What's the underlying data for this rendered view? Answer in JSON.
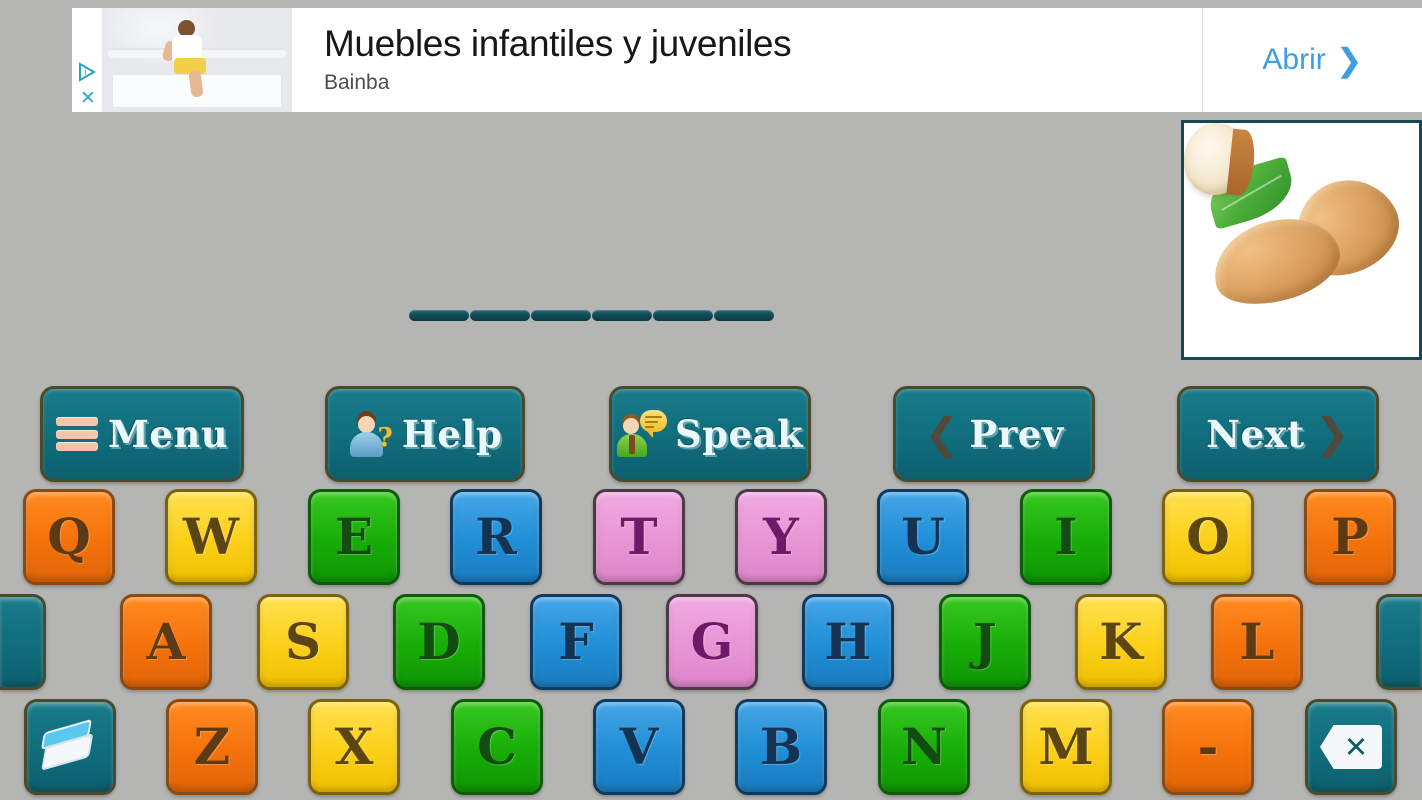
{
  "screen": {
    "background_color": "#b5b5b4",
    "app_kind": "hangman-style word guessing game keyboard"
  },
  "ad": {
    "title": "Muebles infantiles y juveniles",
    "advertiser": "Bainba",
    "cta_label": "Abrir",
    "cta_chevron": "❯",
    "adchoices_icon": "adchoices-triangle-i-icon",
    "close_icon": "✕",
    "thumbnail_icon": "nursery-furniture-photo",
    "accent_color": "#3e9fe0"
  },
  "picture_card": {
    "image_icon": "almonds-photo",
    "border_color": "#15484f",
    "background_color": "#ffffff"
  },
  "word": {
    "slot_count": 6,
    "slots": [
      "",
      "",
      "",
      "",
      "",
      ""
    ],
    "slot_color": "#114854"
  },
  "actions": [
    {
      "id": "menu",
      "label": "Menu",
      "icon": "hamburger-icon"
    },
    {
      "id": "help",
      "label": "Help",
      "icon": "person-question-icon"
    },
    {
      "id": "speak",
      "label": "Speak",
      "icon": "person-speech-bubble-icon"
    },
    {
      "id": "prev",
      "label": "Prev",
      "icon": "chevron-left-icon"
    },
    {
      "id": "next",
      "label": "Next",
      "icon": "chevron-right-icon"
    }
  ],
  "action_style": {
    "fill_color": "#11707f",
    "border_color": "#4b4a2a",
    "text_color": "#eaf7fb"
  },
  "keyboard": {
    "rows": [
      {
        "id": "row-1",
        "keys": [
          {
            "label": "Q",
            "color": "orange"
          },
          {
            "label": "W",
            "color": "yellow"
          },
          {
            "label": "E",
            "color": "green"
          },
          {
            "label": "R",
            "color": "blue"
          },
          {
            "label": "T",
            "color": "pink"
          },
          {
            "label": "Y",
            "color": "pink"
          },
          {
            "label": "U",
            "color": "blue"
          },
          {
            "label": "I",
            "color": "green"
          },
          {
            "label": "O",
            "color": "yellow"
          },
          {
            "label": "P",
            "color": "orange"
          }
        ]
      },
      {
        "id": "row-2",
        "keys": [
          {
            "label": "",
            "color": "teal",
            "icon": "edge-key-left",
            "partial": true
          },
          {
            "label": "A",
            "color": "orange"
          },
          {
            "label": "S",
            "color": "yellow"
          },
          {
            "label": "D",
            "color": "green"
          },
          {
            "label": "F",
            "color": "blue"
          },
          {
            "label": "G",
            "color": "pink"
          },
          {
            "label": "H",
            "color": "blue"
          },
          {
            "label": "J",
            "color": "green"
          },
          {
            "label": "K",
            "color": "yellow"
          },
          {
            "label": "L",
            "color": "orange"
          },
          {
            "label": "",
            "color": "teal",
            "icon": "edge-key-right",
            "partial": true
          }
        ]
      },
      {
        "id": "row-3",
        "keys": [
          {
            "label": "",
            "color": "teal",
            "icon": "eraser-icon"
          },
          {
            "label": "Z",
            "color": "orange"
          },
          {
            "label": "X",
            "color": "yellow"
          },
          {
            "label": "C",
            "color": "green"
          },
          {
            "label": "V",
            "color": "blue"
          },
          {
            "label": "B",
            "color": "blue"
          },
          {
            "label": "N",
            "color": "green"
          },
          {
            "label": "M",
            "color": "yellow"
          },
          {
            "label": "-",
            "color": "orange"
          },
          {
            "label": "",
            "color": "teal",
            "icon": "backspace-icon"
          }
        ]
      }
    ],
    "key_colors": {
      "orange": "#f4720b",
      "yellow": "#fbd018",
      "green": "#17ad07",
      "blue": "#1f8ed6",
      "pink": "#e895d5",
      "teal": "#11707f"
    }
  }
}
